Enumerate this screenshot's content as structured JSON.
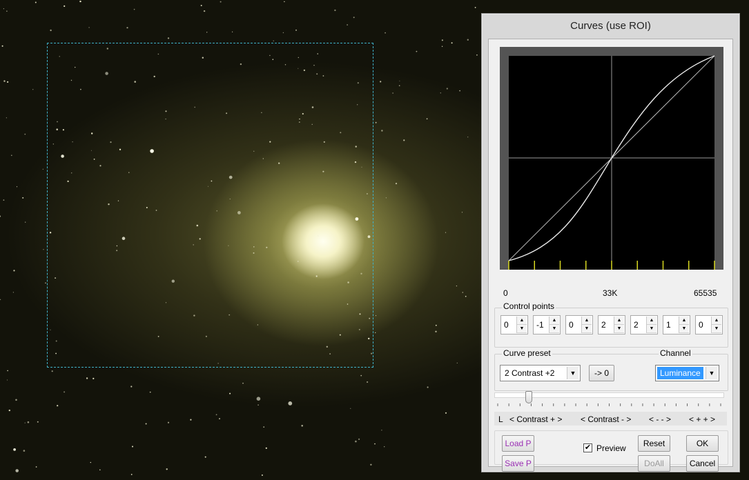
{
  "dialog": {
    "title": "Curves (use ROI)",
    "axis": {
      "min": "0",
      "mid": "33K",
      "max": "65535"
    },
    "control_points": {
      "label": "Control points",
      "values": [
        "0",
        "-1",
        "0",
        "2",
        "2",
        "1",
        "0"
      ]
    },
    "curve_preset": {
      "label": "Curve preset",
      "value": "2  Contrast +2",
      "apply_label": "-> 0"
    },
    "channel": {
      "label": "Channel",
      "value": "Luminance"
    },
    "slider": {
      "position": 0.14
    },
    "strip": {
      "l": "L",
      "contrast_plus": "< Contrast + >",
      "contrast_minus": "< Contrast - >",
      "minus_minus": "< -   - >",
      "plus_plus": "< + + >"
    },
    "buttons": {
      "load": "Load P",
      "save": "Save P",
      "reset": "Reset",
      "ok": "OK",
      "doall": "DoAll",
      "cancel": "Cancel"
    },
    "preview": {
      "label": "Preview",
      "checked": true
    }
  },
  "colors": {
    "roi": "#3fb2c9",
    "purple_button": "#9a2fb4",
    "channel_highlight": "#3399ff",
    "tick": "#d8d820"
  }
}
